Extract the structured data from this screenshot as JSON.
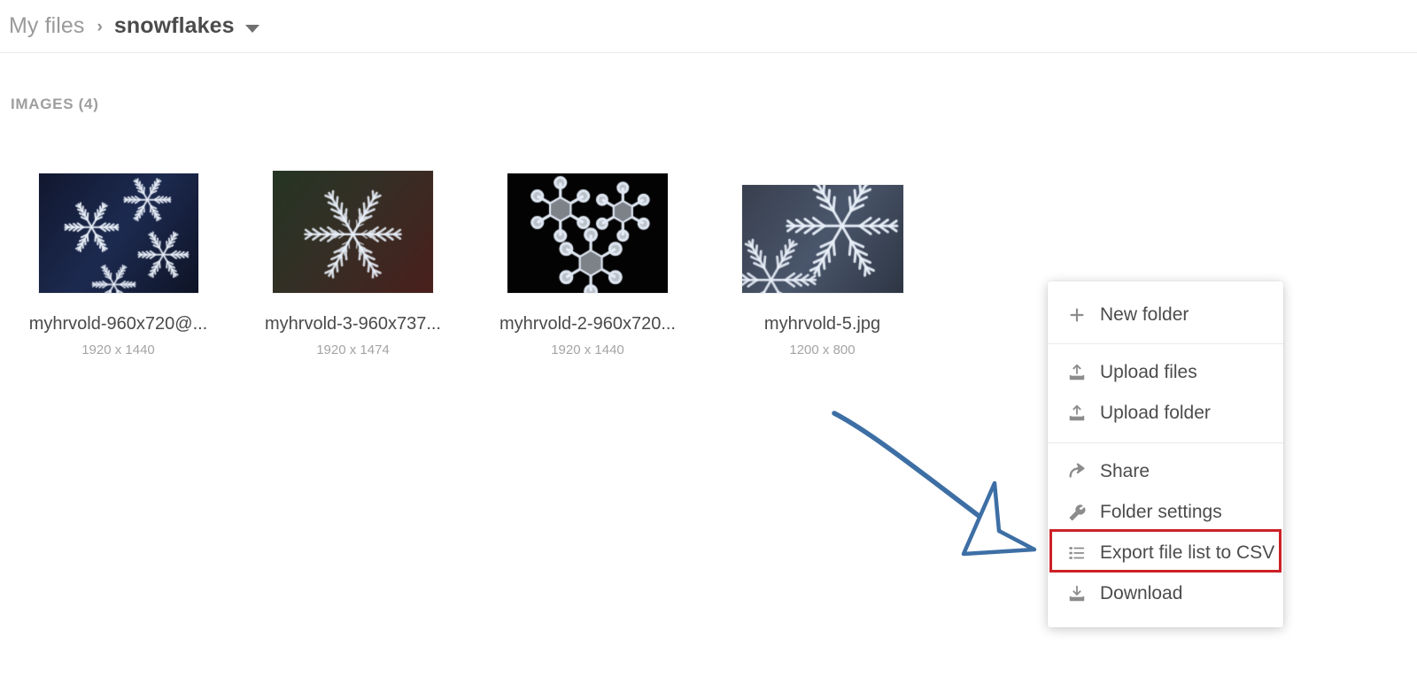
{
  "breadcrumb": {
    "root_label": "My files",
    "separator": "›",
    "current_label": "snowflakes",
    "caret_icon": "caret-down-icon"
  },
  "section": {
    "title": "IMAGES (4)"
  },
  "files": [
    {
      "name": "myhrvold-960x720@...",
      "dimensions": "1920 x 1440",
      "thumb_type": "snowflakes-navy",
      "thumb_width": 180,
      "thumb_height": 135
    },
    {
      "name": "myhrvold-3-960x737...",
      "dimensions": "1920 x 1474",
      "thumb_type": "snowflake-green-red",
      "thumb_width": 181,
      "thumb_height": 138
    },
    {
      "name": "myhrvold-2-960x720...",
      "dimensions": "1920 x 1440",
      "thumb_type": "snowflakes-black",
      "thumb_width": 181,
      "thumb_height": 135
    },
    {
      "name": "myhrvold-5.jpg",
      "dimensions": "1200 x 800",
      "thumb_type": "snowflakes-slate",
      "thumb_width": 182,
      "thumb_height": 122
    }
  ],
  "context_menu": {
    "groups": [
      {
        "items": [
          {
            "label": "New folder",
            "icon": "plus-icon",
            "highlighted": false
          }
        ]
      },
      {
        "items": [
          {
            "label": "Upload files",
            "icon": "upload-icon",
            "highlighted": false
          },
          {
            "label": "Upload folder",
            "icon": "upload-icon",
            "highlighted": false
          }
        ]
      },
      {
        "items": [
          {
            "label": "Share",
            "icon": "share-arrow-icon",
            "highlighted": false
          },
          {
            "label": "Folder settings",
            "icon": "wrench-icon",
            "highlighted": false
          },
          {
            "label": "Export file list to CSV",
            "icon": "list-icon",
            "highlighted": true
          },
          {
            "label": "Download",
            "icon": "download-icon",
            "highlighted": false
          }
        ]
      }
    ]
  },
  "annotations": {
    "arrow": {
      "name": "pointer-arrow",
      "color": "#3d6fa5",
      "points_to": "Export file list to CSV"
    },
    "highlight_box": {
      "name": "export-csv-highlight",
      "color": "#cc2127"
    }
  },
  "colors": {
    "accent_red": "#cc2127",
    "accent_blue": "#3d6fa5",
    "text_primary": "#4a4a4a",
    "text_muted": "#9e9e9e",
    "divider": "#e8e8e8"
  }
}
